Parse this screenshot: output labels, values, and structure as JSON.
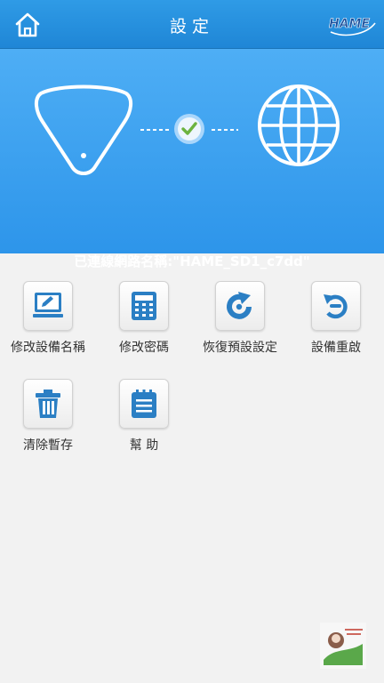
{
  "header": {
    "title": "設定",
    "home_icon": "home-icon",
    "logo_text": "HAME"
  },
  "status": {
    "connected_label": "已連線網路名稱:\"HAME_SD1_c7dd\""
  },
  "colors": {
    "header_blue": "#2a93e0",
    "hero_blue": "#3ea3f0",
    "icon_blue": "#2b7fc4",
    "check_green": "#6cb33f",
    "background": "#f2f2f2"
  },
  "actions": [
    {
      "label": "修改設備名稱",
      "icon": "edit-monitor-icon"
    },
    {
      "label": "修改密碼",
      "icon": "calculator-keypad-icon"
    },
    {
      "label": "恢復預設設定",
      "icon": "reset-arrow-icon"
    },
    {
      "label": "設備重啟",
      "icon": "restart-icon"
    },
    {
      "label": "清除暫存",
      "icon": "trash-icon"
    },
    {
      "label": "幫 助",
      "icon": "notepad-help-icon"
    }
  ]
}
